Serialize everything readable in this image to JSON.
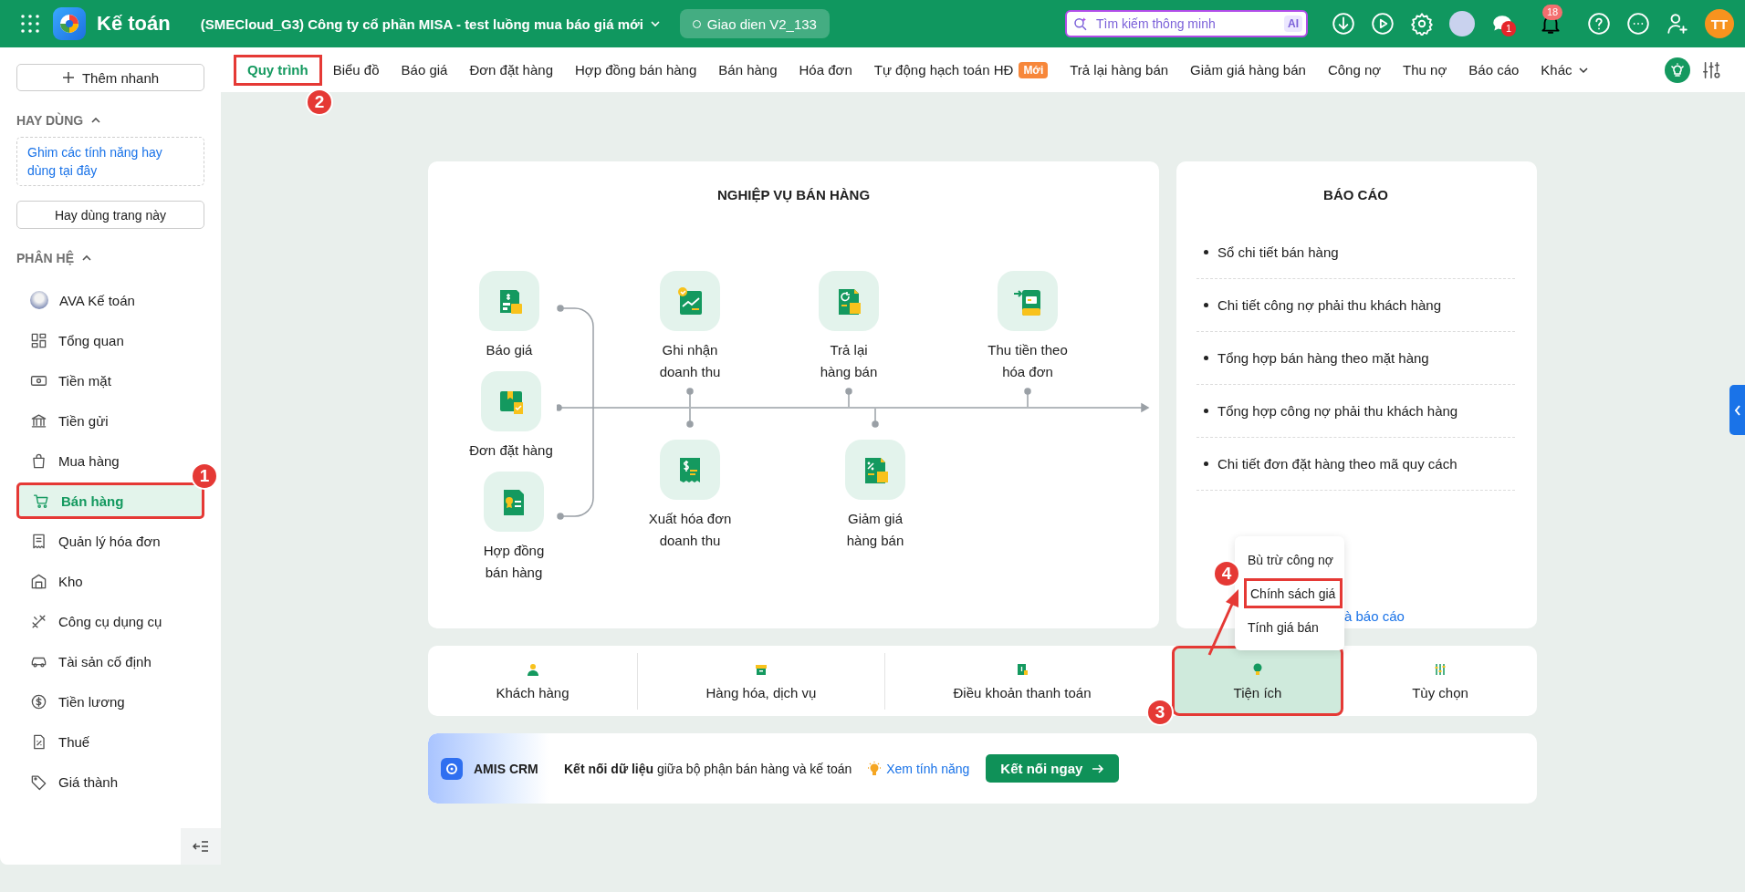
{
  "app": {
    "title": "Kế toán",
    "company": "(SMECloud_G3) Công ty cổ phần MISA - test luồng mua báo giá mới",
    "environment": "Giao dien V2_133"
  },
  "search": {
    "placeholder": "Tìm kiếm thông minh",
    "badge": "AI"
  },
  "notifications": {
    "chat_count": "1",
    "bell_count": "18"
  },
  "user": {
    "initials": "TT"
  },
  "sidebar": {
    "quick_add": "Thêm nhanh",
    "favorites_title": "HAY DÙNG",
    "favorites_hint": "Ghim các tính năng hay dùng tại đây",
    "favorites_button": "Hay dùng trang này",
    "modules_title": "PHÂN HỆ",
    "items": [
      {
        "label": "AVA Kế toán",
        "selected": false
      },
      {
        "label": "Tổng quan",
        "selected": false
      },
      {
        "label": "Tiền mặt",
        "selected": false
      },
      {
        "label": "Tiền gửi",
        "selected": false
      },
      {
        "label": "Mua hàng",
        "selected": false
      },
      {
        "label": "Bán hàng",
        "selected": true,
        "callout": "1"
      },
      {
        "label": "Quản lý hóa đơn",
        "selected": false
      },
      {
        "label": "Kho",
        "selected": false
      },
      {
        "label": "Công cụ dụng cụ",
        "selected": false
      },
      {
        "label": "Tài sản cố định",
        "selected": false
      },
      {
        "label": "Tiền lương",
        "selected": false
      },
      {
        "label": "Thuế",
        "selected": false
      },
      {
        "label": "Giá thành",
        "selected": false
      }
    ]
  },
  "tabs": [
    {
      "label": "Quy trình",
      "selected": true,
      "callout": "2"
    },
    {
      "label": "Biểu đồ",
      "selected": false
    },
    {
      "label": "Báo giá",
      "selected": false
    },
    {
      "label": "Đơn đặt hàng",
      "selected": false
    },
    {
      "label": "Hợp đồng bán hàng",
      "selected": false
    },
    {
      "label": "Bán hàng",
      "selected": false
    },
    {
      "label": "Hóa đơn",
      "selected": false
    },
    {
      "label": "Tự động hạch toán HĐ",
      "selected": false,
      "badge": "Mới"
    },
    {
      "label": "Trả lại hàng bán",
      "selected": false
    },
    {
      "label": "Giảm giá hàng bán",
      "selected": false
    },
    {
      "label": "Công nợ",
      "selected": false
    },
    {
      "label": "Thu nợ",
      "selected": false
    },
    {
      "label": "Báo cáo",
      "selected": false
    },
    {
      "label": "Khác",
      "selected": false,
      "dropdown": true
    }
  ],
  "process": {
    "title": "NGHIỆP VỤ BÁN HÀNG",
    "steps": [
      {
        "label": "Báo giá"
      },
      {
        "label": "Đơn đặt hàng"
      },
      {
        "label": "Hợp đồng bán hàng"
      },
      {
        "label": "Ghi nhận doanh thu"
      },
      {
        "label": "Xuất hóa đơn doanh thu"
      },
      {
        "label": "Trả lại hàng bán"
      },
      {
        "label": "Giảm giá hàng bán"
      },
      {
        "label": "Thu tiền theo hóa đơn"
      }
    ]
  },
  "reports": {
    "title": "BÁO CÁO",
    "items": [
      "Sổ chi tiết bán hàng",
      "Chi tiết công nợ phải thu khách hàng",
      "Tổng hợp bán hàng theo mặt hàng",
      "Tổng hợp công nợ phải thu khách hàng",
      "Chi tiết đơn đặt hàng theo mã quy cách"
    ],
    "link": "à báo cáo"
  },
  "utility_menu": [
    {
      "label": "Bù trừ công nợ"
    },
    {
      "label": "Chính sách giá",
      "callout": "4"
    },
    {
      "label": "Tính giá bán"
    }
  ],
  "categories": [
    {
      "label": "Khách hàng",
      "selected": false
    },
    {
      "label": "Hàng hóa, dịch vụ",
      "selected": false
    },
    {
      "label": "Điều khoản thanh toán",
      "selected": false
    },
    {
      "label": "Tiện ích",
      "selected": true,
      "callout": "3"
    },
    {
      "label": "Tùy chọn",
      "selected": false
    }
  ],
  "crm": {
    "name": "AMIS CRM",
    "message": "**Kết nối dữ liệu** giữa bộ phận bán hàng và kế toán",
    "features_link": "Xem tính năng",
    "connect_button": "Kết nối ngay"
  }
}
